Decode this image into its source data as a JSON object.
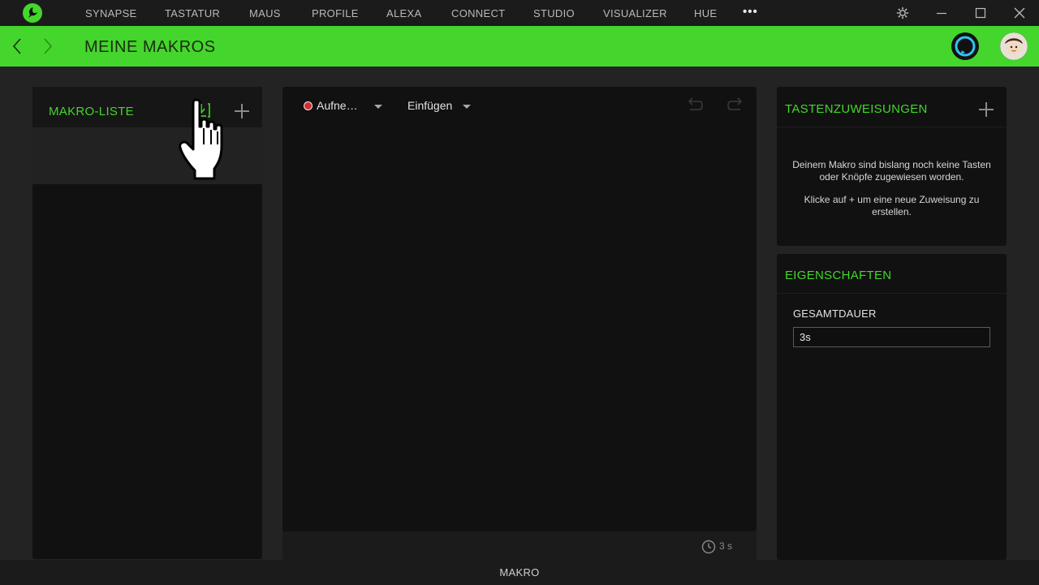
{
  "topbar": {
    "nav": [
      {
        "label": "SYNAPSE"
      },
      {
        "label": "TASTATUR"
      },
      {
        "label": "MAUS"
      },
      {
        "label": "PROFILE"
      },
      {
        "label": "ALEXA"
      },
      {
        "label": "CONNECT"
      },
      {
        "label": "STUDIO"
      },
      {
        "label": "VISUALIZER"
      },
      {
        "label": "HUE"
      }
    ],
    "more": "•••",
    "icons": [
      "razer-logo-icon",
      "settings-icon",
      "minimize-icon",
      "maximize-icon",
      "close-icon"
    ]
  },
  "header": {
    "title": "MEINE MAKROS",
    "icons": [
      "back-arrow-icon",
      "forward-arrow-icon",
      "alexa-icon",
      "avatar"
    ]
  },
  "macro_list": {
    "title": "MAKRO-LISTE",
    "icons": [
      "import-icon",
      "add-icon",
      "hand-cursor-icon"
    ]
  },
  "editor": {
    "record_label": "Aufne…",
    "insert_label": "Einfügen",
    "icons": [
      "record-dot-icon",
      "undo-icon",
      "redo-icon",
      "clock-icon"
    ],
    "duration": "3 s"
  },
  "key_assignments": {
    "title": "TASTENZUWEISUNGEN",
    "message1": "Deinem Makro sind bislang noch keine Tasten oder Knöpfe zugewiesen worden.",
    "message2": "Klicke auf + um eine neue Zuweisung zu erstellen."
  },
  "properties": {
    "title": "EIGENSCHAFTEN",
    "total_duration_label": "GESAMTDAUER",
    "total_duration_value": "3s"
  },
  "bottom_bar": {
    "label": "MAKRO"
  },
  "colors": {
    "accent": "#44d62c",
    "background": "#232323",
    "panel": "#111111",
    "record": "#d32f2f"
  }
}
